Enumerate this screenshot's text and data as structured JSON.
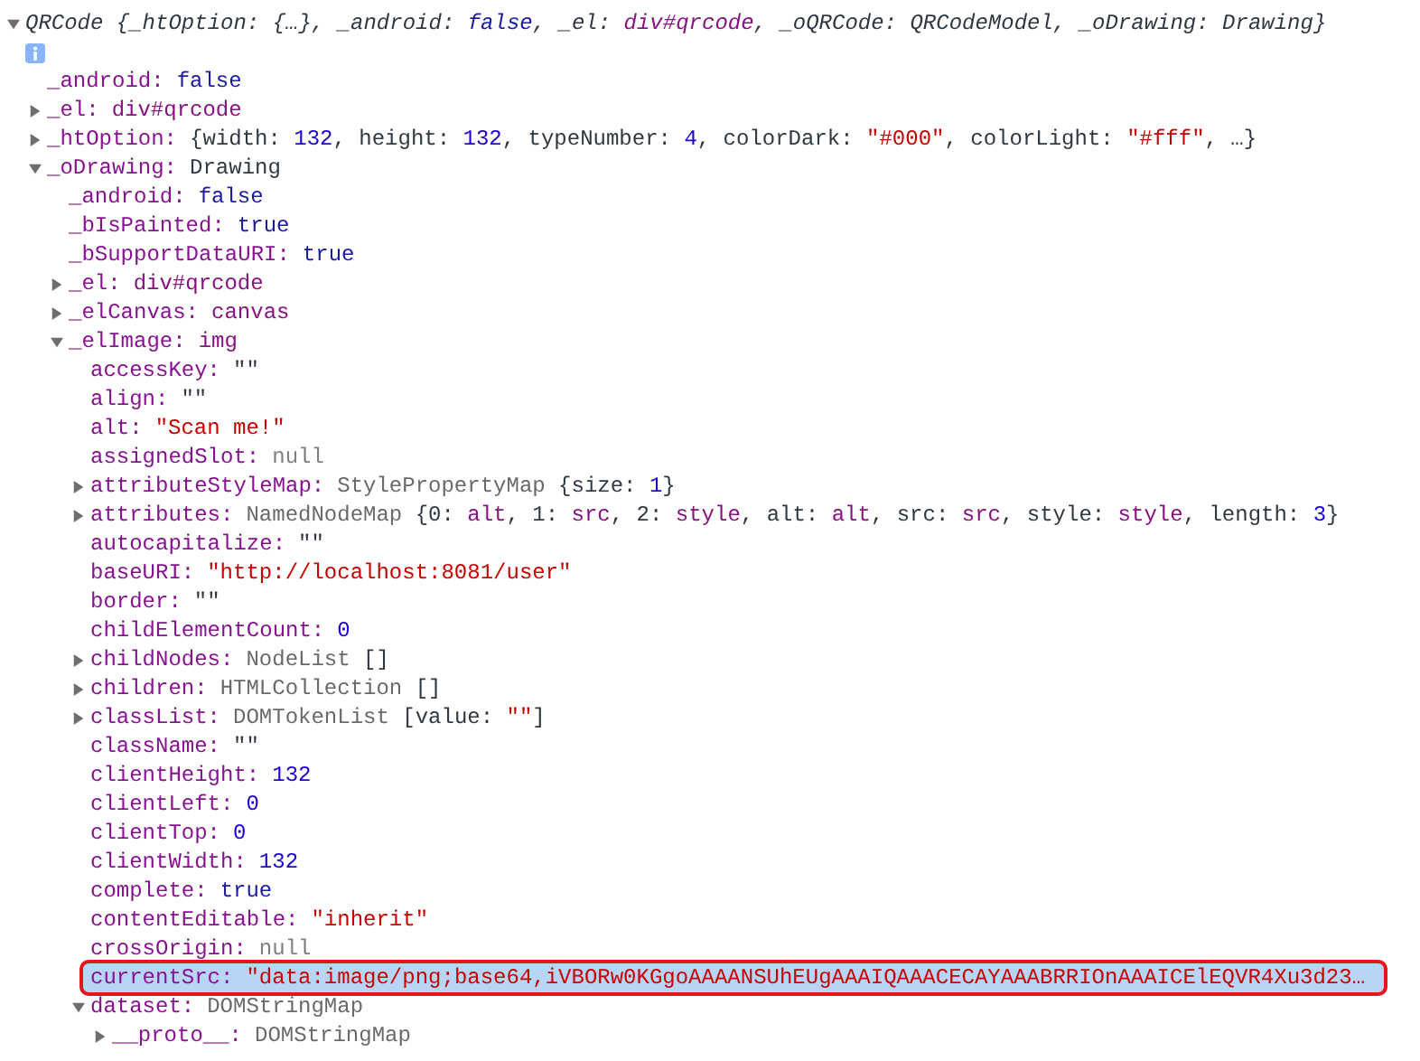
{
  "console": {
    "tree": [
      {
        "kind": "branch",
        "expanded": true,
        "selected": false,
        "value": [
          {
            "kind": "object",
            "v": "QRCode {_htOption: {…}, _android: "
          },
          {
            "kind": "boolean",
            "v": "false"
          },
          {
            "kind": "object",
            "v": ", _el: "
          },
          {
            "kind": "element",
            "v": "div#qrcode"
          },
          {
            "kind": "object",
            "v": ", _oQRCode: QRCodeModel, _oDrawing: Drawing}"
          }
        ],
        "children": [
          {
            "kind": "leaf",
            "selected": false,
            "key": "_android:",
            "value": [
              {
                "kind": "boolean",
                "v": "false"
              }
            ]
          },
          {
            "kind": "branch",
            "expanded": false,
            "selected": false,
            "key": "_el:",
            "value": [
              {
                "kind": "element",
                "v": "div#qrcode"
              }
            ]
          },
          {
            "kind": "branch",
            "expanded": false,
            "selected": false,
            "key": "_htOption:",
            "value": [
              {
                "kind": "object",
                "v": "{width: "
              },
              {
                "kind": "number",
                "v": "132"
              },
              {
                "kind": "object",
                "v": ", height: "
              },
              {
                "kind": "number",
                "v": "132"
              },
              {
                "kind": "object",
                "v": ", typeNumber: "
              },
              {
                "kind": "number",
                "v": "4"
              },
              {
                "kind": "object",
                "v": ", colorDark: "
              },
              {
                "kind": "string",
                "v": "\"#000\""
              },
              {
                "kind": "object",
                "v": ", colorLight: "
              },
              {
                "kind": "string",
                "v": "\"#fff\""
              },
              {
                "kind": "object",
                "v": ", …}"
              }
            ]
          },
          {
            "kind": "branch",
            "expanded": true,
            "selected": false,
            "key": "_oDrawing:",
            "value": [
              {
                "kind": "object",
                "v": "Drawing"
              }
            ],
            "children": [
              {
                "kind": "leaf",
                "selected": false,
                "key": "_android:",
                "value": [
                  {
                    "kind": "boolean",
                    "v": "false"
                  }
                ]
              },
              {
                "kind": "leaf",
                "selected": false,
                "key": "_bIsPainted:",
                "value": [
                  {
                    "kind": "boolean",
                    "v": "true"
                  }
                ]
              },
              {
                "kind": "leaf",
                "selected": false,
                "key": "_bSupportDataURI:",
                "value": [
                  {
                    "kind": "boolean",
                    "v": "true"
                  }
                ]
              },
              {
                "kind": "branch",
                "expanded": false,
                "selected": false,
                "key": "_el:",
                "value": [
                  {
                    "kind": "element",
                    "v": "div#qrcode"
                  }
                ]
              },
              {
                "kind": "branch",
                "expanded": false,
                "selected": false,
                "key": "_elCanvas:",
                "value": [
                  {
                    "kind": "element",
                    "v": "canvas"
                  }
                ]
              },
              {
                "kind": "branch",
                "expanded": true,
                "selected": false,
                "key": "_elImage:",
                "value": [
                  {
                    "kind": "element",
                    "v": "img"
                  }
                ],
                "children": [
                  {
                    "kind": "leaf",
                    "selected": false,
                    "key": "accessKey:",
                    "value": [
                      {
                        "kind": "object",
                        "v": "\"\""
                      }
                    ]
                  },
                  {
                    "kind": "leaf",
                    "selected": false,
                    "key": "align:",
                    "value": [
                      {
                        "kind": "object",
                        "v": "\"\""
                      }
                    ]
                  },
                  {
                    "kind": "leaf",
                    "selected": false,
                    "key": "alt:",
                    "value": [
                      {
                        "kind": "string",
                        "v": "\"Scan me!\""
                      }
                    ]
                  },
                  {
                    "kind": "leaf",
                    "selected": false,
                    "key": "assignedSlot:",
                    "value": [
                      {
                        "kind": "null",
                        "v": "null"
                      }
                    ]
                  },
                  {
                    "kind": "branch",
                    "expanded": false,
                    "selected": false,
                    "key": "attributeStyleMap:",
                    "value": [
                      {
                        "kind": "class",
                        "v": "StylePropertyMap"
                      },
                      {
                        "kind": "object",
                        "v": " {size: "
                      },
                      {
                        "kind": "number",
                        "v": "1"
                      },
                      {
                        "kind": "object",
                        "v": "}"
                      }
                    ]
                  },
                  {
                    "kind": "branch",
                    "expanded": false,
                    "selected": false,
                    "key": "attributes:",
                    "value": [
                      {
                        "kind": "class",
                        "v": "NamedNodeMap"
                      },
                      {
                        "kind": "object",
                        "v": " {0: "
                      },
                      {
                        "kind": "element",
                        "v": "alt"
                      },
                      {
                        "kind": "object",
                        "v": ", 1: "
                      },
                      {
                        "kind": "element",
                        "v": "src"
                      },
                      {
                        "kind": "object",
                        "v": ", 2: "
                      },
                      {
                        "kind": "element",
                        "v": "style"
                      },
                      {
                        "kind": "object",
                        "v": ", alt: "
                      },
                      {
                        "kind": "element",
                        "v": "alt"
                      },
                      {
                        "kind": "object",
                        "v": ", src: "
                      },
                      {
                        "kind": "element",
                        "v": "src"
                      },
                      {
                        "kind": "object",
                        "v": ", style: "
                      },
                      {
                        "kind": "element",
                        "v": "style"
                      },
                      {
                        "kind": "object",
                        "v": ", length: "
                      },
                      {
                        "kind": "number",
                        "v": "3"
                      },
                      {
                        "kind": "object",
                        "v": "}"
                      }
                    ]
                  },
                  {
                    "kind": "leaf",
                    "selected": false,
                    "key": "autocapitalize:",
                    "value": [
                      {
                        "kind": "object",
                        "v": "\"\""
                      }
                    ]
                  },
                  {
                    "kind": "leaf",
                    "selected": false,
                    "key": "baseURI:",
                    "value": [
                      {
                        "kind": "string",
                        "v": "\"http://localhost:8081/user\""
                      }
                    ]
                  },
                  {
                    "kind": "leaf",
                    "selected": false,
                    "key": "border:",
                    "value": [
                      {
                        "kind": "object",
                        "v": "\"\""
                      }
                    ]
                  },
                  {
                    "kind": "leaf",
                    "selected": false,
                    "key": "childElementCount:",
                    "value": [
                      {
                        "kind": "number",
                        "v": "0"
                      }
                    ]
                  },
                  {
                    "kind": "branch",
                    "expanded": false,
                    "selected": false,
                    "key": "childNodes:",
                    "value": [
                      {
                        "kind": "class",
                        "v": "NodeList"
                      },
                      {
                        "kind": "object",
                        "v": " []"
                      }
                    ]
                  },
                  {
                    "kind": "branch",
                    "expanded": false,
                    "selected": false,
                    "key": "children:",
                    "value": [
                      {
                        "kind": "class",
                        "v": "HTMLCollection"
                      },
                      {
                        "kind": "object",
                        "v": " []"
                      }
                    ]
                  },
                  {
                    "kind": "branch",
                    "expanded": false,
                    "selected": false,
                    "key": "classList:",
                    "value": [
                      {
                        "kind": "class",
                        "v": "DOMTokenList"
                      },
                      {
                        "kind": "object",
                        "v": " [value: "
                      },
                      {
                        "kind": "string",
                        "v": "\"\""
                      },
                      {
                        "kind": "object",
                        "v": "]"
                      }
                    ]
                  },
                  {
                    "kind": "leaf",
                    "selected": false,
                    "key": "className:",
                    "value": [
                      {
                        "kind": "object",
                        "v": "\"\""
                      }
                    ]
                  },
                  {
                    "kind": "leaf",
                    "selected": false,
                    "key": "clientHeight:",
                    "value": [
                      {
                        "kind": "number",
                        "v": "132"
                      }
                    ]
                  },
                  {
                    "kind": "leaf",
                    "selected": false,
                    "key": "clientLeft:",
                    "value": [
                      {
                        "kind": "number",
                        "v": "0"
                      }
                    ]
                  },
                  {
                    "kind": "leaf",
                    "selected": false,
                    "key": "clientTop:",
                    "value": [
                      {
                        "kind": "number",
                        "v": "0"
                      }
                    ]
                  },
                  {
                    "kind": "leaf",
                    "selected": false,
                    "key": "clientWidth:",
                    "value": [
                      {
                        "kind": "number",
                        "v": "132"
                      }
                    ]
                  },
                  {
                    "kind": "leaf",
                    "selected": false,
                    "key": "complete:",
                    "value": [
                      {
                        "kind": "boolean",
                        "v": "true"
                      }
                    ]
                  },
                  {
                    "kind": "leaf",
                    "selected": false,
                    "key": "contentEditable:",
                    "value": [
                      {
                        "kind": "string",
                        "v": "\"inherit\""
                      }
                    ]
                  },
                  {
                    "kind": "leaf",
                    "selected": false,
                    "key": "crossOrigin:",
                    "value": [
                      {
                        "kind": "null",
                        "v": "null"
                      }
                    ]
                  },
                  {
                    "kind": "leaf",
                    "selected": true,
                    "key": "currentSrc:",
                    "value": [
                      {
                        "kind": "string",
                        "v": "\"data:image/png;base64,iVBORw0KGgoAAAANSUhEUgAAAIQAAACECAYAAABRRIOnAAAICElEQVR4Xu3d23…"
                      }
                    ]
                  },
                  {
                    "kind": "branch",
                    "expanded": true,
                    "selected": false,
                    "key": "dataset:",
                    "value": [
                      {
                        "kind": "class",
                        "v": "DOMStringMap"
                      }
                    ],
                    "children": [
                      {
                        "kind": "branch",
                        "expanded": false,
                        "selected": false,
                        "key": "__proto__:",
                        "value": [
                          {
                            "kind": "class",
                            "v": "DOMStringMap"
                          }
                        ]
                      }
                    ]
                  }
                ]
              }
            ]
          }
        ]
      }
    ]
  }
}
